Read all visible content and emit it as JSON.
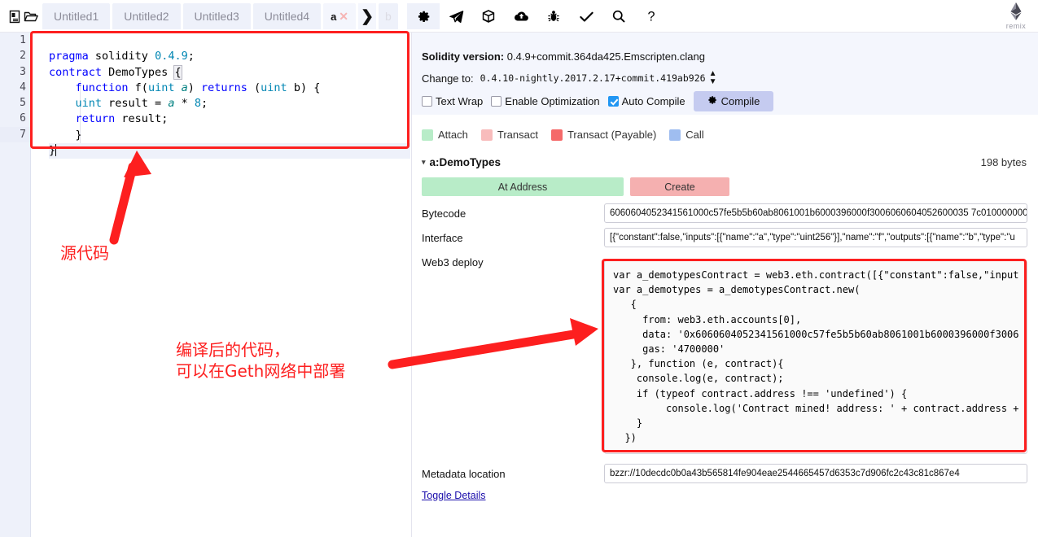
{
  "app": {
    "logo_label": "remix",
    "logo_icon": "ethereum-diamond-icon"
  },
  "topbar": {
    "left_icons": [
      {
        "name": "new-file-icon",
        "label": "New File"
      },
      {
        "name": "open-folder-icon",
        "label": "Open Folder"
      }
    ],
    "tabs": [
      {
        "label": "Untitled1",
        "active": false
      },
      {
        "label": "Untitled2",
        "active": false
      },
      {
        "label": "Untitled3",
        "active": false
      },
      {
        "label": "Untitled4",
        "active": false
      },
      {
        "label": "a",
        "active": true
      },
      {
        "label": "b",
        "active": false
      }
    ],
    "tab_close_glyph": "✕",
    "tab_next_glyph": "❯",
    "tab_more_glyph": "»",
    "tools": [
      {
        "name": "gear-icon",
        "label": "Settings",
        "selected": true
      },
      {
        "name": "paper-plane-icon",
        "label": "Run"
      },
      {
        "name": "cube-icon",
        "label": "Compile"
      },
      {
        "name": "cloud-upload-icon",
        "label": "Swarm"
      },
      {
        "name": "bug-icon",
        "label": "Debugger"
      },
      {
        "name": "check-icon",
        "label": "Analysis"
      },
      {
        "name": "search-icon",
        "label": "Support"
      },
      {
        "name": "question-icon",
        "label": "Help"
      }
    ]
  },
  "editor": {
    "line_numbers": [
      "1",
      "2",
      "3",
      "4",
      "5",
      "6",
      "7"
    ],
    "fold_lines": [
      2,
      3
    ],
    "fold_glyph": "▾",
    "code_lines": [
      "pragma solidity 0.4.9;",
      "contract DemoTypes {",
      "    function f(uint a) returns (uint b) {",
      "    uint result = a * 8;",
      "    return result;",
      "    }",
      "}"
    ],
    "active_line": 7
  },
  "compiler": {
    "version_label": "Solidity version:",
    "version_value": "0.4.9+commit.364da425.Emscripten.clang",
    "change_to_label": "Change to:",
    "change_to_value": "0.4.10-nightly.2017.2.17+commit.419ab926",
    "options": [
      {
        "label": "Text Wrap",
        "checked": false
      },
      {
        "label": "Enable Optimization",
        "checked": false
      },
      {
        "label": "Auto Compile",
        "checked": true
      }
    ],
    "compile_button": "Compile",
    "compile_icon": "gear-icon"
  },
  "legend": [
    {
      "label": "Attach",
      "color": "#b8ecc8"
    },
    {
      "label": "Transact",
      "color": "#f8bcbc"
    },
    {
      "label": "Transact (Payable)",
      "color": "#f56a6a"
    },
    {
      "label": "Call",
      "color": "#9fbdf0"
    }
  ],
  "contract": {
    "name": "a:DemoTypes",
    "size": "198 bytes",
    "expand_glyph": "▾",
    "at_address_button": "At Address",
    "create_button": "Create",
    "fields": [
      {
        "label": "Bytecode",
        "value": "6060604052341561000c57fe5b5b60ab8061001b6000396000f3006060604052600035 7c0100000000"
      },
      {
        "label": "Interface",
        "value": "[{\"constant\":false,\"inputs\":[{\"name\":\"a\",\"type\":\"uint256\"}],\"name\":\"f\",\"outputs\":[{\"name\":\"b\",\"type\":\"u"
      }
    ],
    "web3_label": "Web3 deploy",
    "web3_code": "var a_demotypesContract = web3.eth.contract([{\"constant\":false,\"input\nvar a_demotypes = a_demotypesContract.new(\n   {\n     from: web3.eth.accounts[0],\n     data: '0x6060604052341561000c57fe5b5b60ab8061001b6000396000f3006\n     gas: '4700000'\n   }, function (e, contract){\n    console.log(e, contract);\n    if (typeof contract.address !== 'undefined') {\n         console.log('Contract mined! address: ' + contract.address +\n    }\n  })",
    "metadata_label": "Metadata location",
    "metadata_value": "bzzr://10decdc0b0a43b565814fe904eae2544665457d6353c7d906fc2c43c81c867e4",
    "toggle_details": "Toggle Details"
  },
  "annotations": {
    "accent_color": "#fd1f1f",
    "source_code_note": "源代码",
    "compiled_note_line1": "编译后的代码，",
    "compiled_note_line2": "可以在Geth网络中部署"
  }
}
